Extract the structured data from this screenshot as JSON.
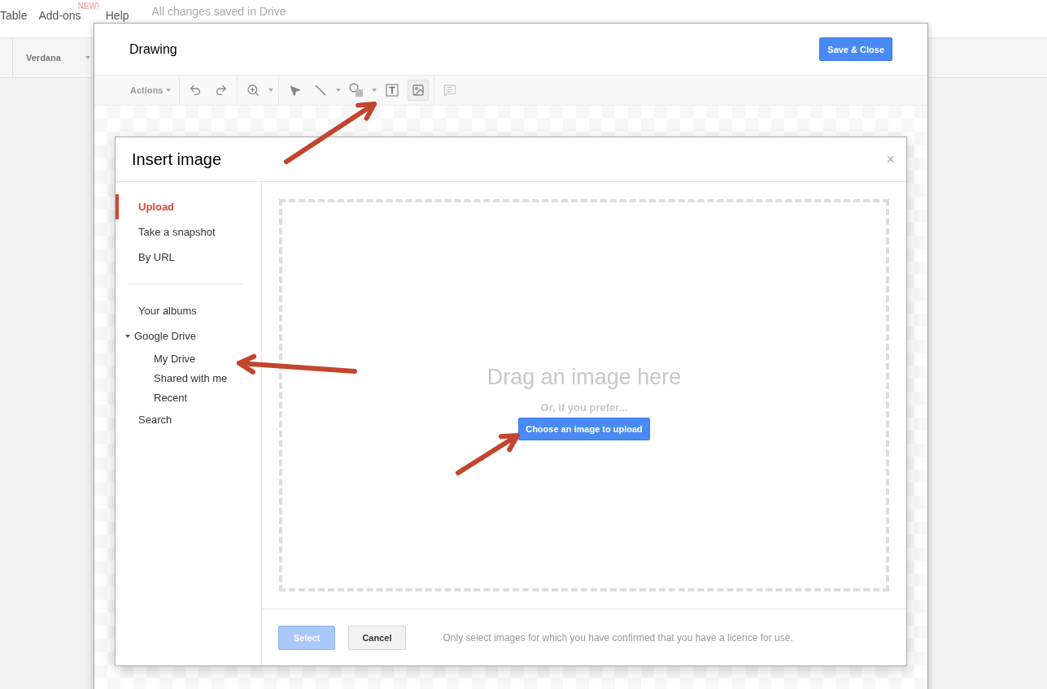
{
  "menubar": {
    "items": [
      {
        "label": "Table"
      },
      {
        "label": "Add-ons",
        "badge": "NEW!"
      },
      {
        "label": "Help"
      }
    ],
    "status": "All changes saved in Drive"
  },
  "formatbar": {
    "font": "Verdana"
  },
  "drawing": {
    "title": "Drawing",
    "save_button": "Save & Close",
    "toolbar": {
      "actions": "Actions",
      "tools": [
        {
          "kind": "undo",
          "selected": false
        },
        {
          "kind": "redo",
          "selected": false
        },
        {
          "kind": "zoom",
          "selected": false
        },
        {
          "kind": "select",
          "selected": false
        },
        {
          "kind": "line",
          "selected": false
        },
        {
          "kind": "shape",
          "selected": false
        },
        {
          "kind": "textbox",
          "selected": false
        },
        {
          "kind": "image",
          "selected": true
        },
        {
          "kind": "comment",
          "selected": false
        }
      ]
    }
  },
  "dialog": {
    "title": "Insert image",
    "close": "×",
    "nav": [
      {
        "label": "Upload",
        "selected": true
      },
      {
        "label": "Take a snapshot",
        "selected": false
      },
      {
        "label": "By URL",
        "selected": false
      }
    ],
    "sources": [
      {
        "label": "Your albums"
      },
      {
        "label": "Google Drive",
        "expanded": true,
        "children": [
          {
            "label": "My Drive"
          },
          {
            "label": "Shared with me"
          },
          {
            "label": "Recent"
          }
        ]
      },
      {
        "label": "Search"
      }
    ],
    "dropzone": {
      "heading": "Drag an image here",
      "subheading": "Or, if you prefer...",
      "button": "Choose an image to upload"
    },
    "footer": {
      "select": {
        "label": "Select",
        "disabled": true
      },
      "cancel": "Cancel",
      "note": "Only select images for which you have confirmed that you have a licence for use."
    }
  }
}
